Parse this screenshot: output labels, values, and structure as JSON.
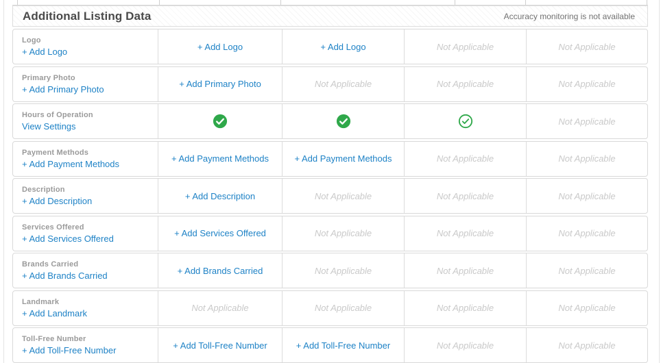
{
  "header": {
    "title": "Additional Listing Data",
    "note": "Accuracy monitoring is not available"
  },
  "na_text": "Not Applicable",
  "colors": {
    "link_blue": "#1e82c6",
    "check_green": "#2fa84a",
    "label_gray": "#9a9a9a",
    "na_gray": "#c9c9c9"
  },
  "rows": [
    {
      "label": "Logo",
      "action": "+ Add Logo",
      "cells": [
        {
          "type": "link",
          "text": "+ Add Logo"
        },
        {
          "type": "link",
          "text": "+ Add Logo"
        },
        {
          "type": "na"
        },
        {
          "type": "na"
        }
      ]
    },
    {
      "label": "Primary Photo",
      "action": "+ Add Primary Photo",
      "cells": [
        {
          "type": "link",
          "text": "+ Add Primary Photo"
        },
        {
          "type": "na"
        },
        {
          "type": "na"
        },
        {
          "type": "na"
        }
      ]
    },
    {
      "label": "Hours of Operation",
      "action": "View Settings",
      "cells": [
        {
          "type": "check-filled"
        },
        {
          "type": "check-filled"
        },
        {
          "type": "check-outline"
        },
        {
          "type": "na"
        }
      ]
    },
    {
      "label": "Payment Methods",
      "action": "+ Add Payment Methods",
      "cells": [
        {
          "type": "link",
          "text": "+ Add Payment Methods"
        },
        {
          "type": "link",
          "text": "+ Add Payment Methods"
        },
        {
          "type": "na"
        },
        {
          "type": "na"
        }
      ]
    },
    {
      "label": "Description",
      "action": "+ Add Description",
      "cells": [
        {
          "type": "link",
          "text": "+ Add Description"
        },
        {
          "type": "na"
        },
        {
          "type": "na"
        },
        {
          "type": "na"
        }
      ]
    },
    {
      "label": "Services Offered",
      "action": "+ Add Services Offered",
      "cells": [
        {
          "type": "link",
          "text": "+ Add Services Offered"
        },
        {
          "type": "na"
        },
        {
          "type": "na"
        },
        {
          "type": "na"
        }
      ]
    },
    {
      "label": "Brands Carried",
      "action": "+ Add Brands Carried",
      "cells": [
        {
          "type": "link",
          "text": "+ Add Brands Carried"
        },
        {
          "type": "na"
        },
        {
          "type": "na"
        },
        {
          "type": "na"
        }
      ]
    },
    {
      "label": "Landmark",
      "action": "+ Add Landmark",
      "cells": [
        {
          "type": "na"
        },
        {
          "type": "na"
        },
        {
          "type": "na"
        },
        {
          "type": "na"
        }
      ]
    },
    {
      "label": "Toll-Free Number",
      "action": "+ Add Toll-Free Number",
      "cells": [
        {
          "type": "link",
          "text": "+ Add Toll-Free Number"
        },
        {
          "type": "link",
          "text": "+ Add Toll-Free Number"
        },
        {
          "type": "na"
        },
        {
          "type": "na"
        }
      ]
    }
  ]
}
